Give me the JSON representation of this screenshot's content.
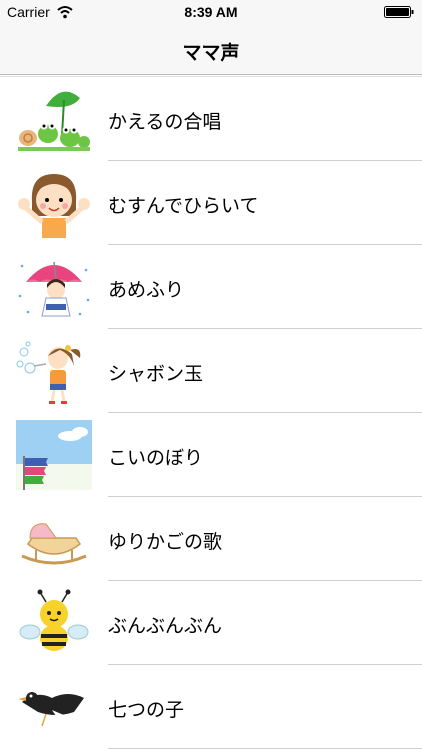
{
  "status_bar": {
    "carrier": "Carrier",
    "time": "8:39 AM"
  },
  "nav": {
    "title": "ママ声"
  },
  "songs": [
    {
      "label": "かえるの合唱",
      "icon": "frogs-icon"
    },
    {
      "label": "むすんでひらいて",
      "icon": "girl-waving-icon"
    },
    {
      "label": "あめふり",
      "icon": "umbrella-girl-icon"
    },
    {
      "label": "シャボン玉",
      "icon": "bubble-girl-icon"
    },
    {
      "label": "こいのぼり",
      "icon": "carp-streamer-icon"
    },
    {
      "label": "ゆりかごの歌",
      "icon": "cradle-icon"
    },
    {
      "label": "ぶんぶんぶん",
      "icon": "bee-icon"
    },
    {
      "label": "七つの子",
      "icon": "crow-icon"
    }
  ]
}
